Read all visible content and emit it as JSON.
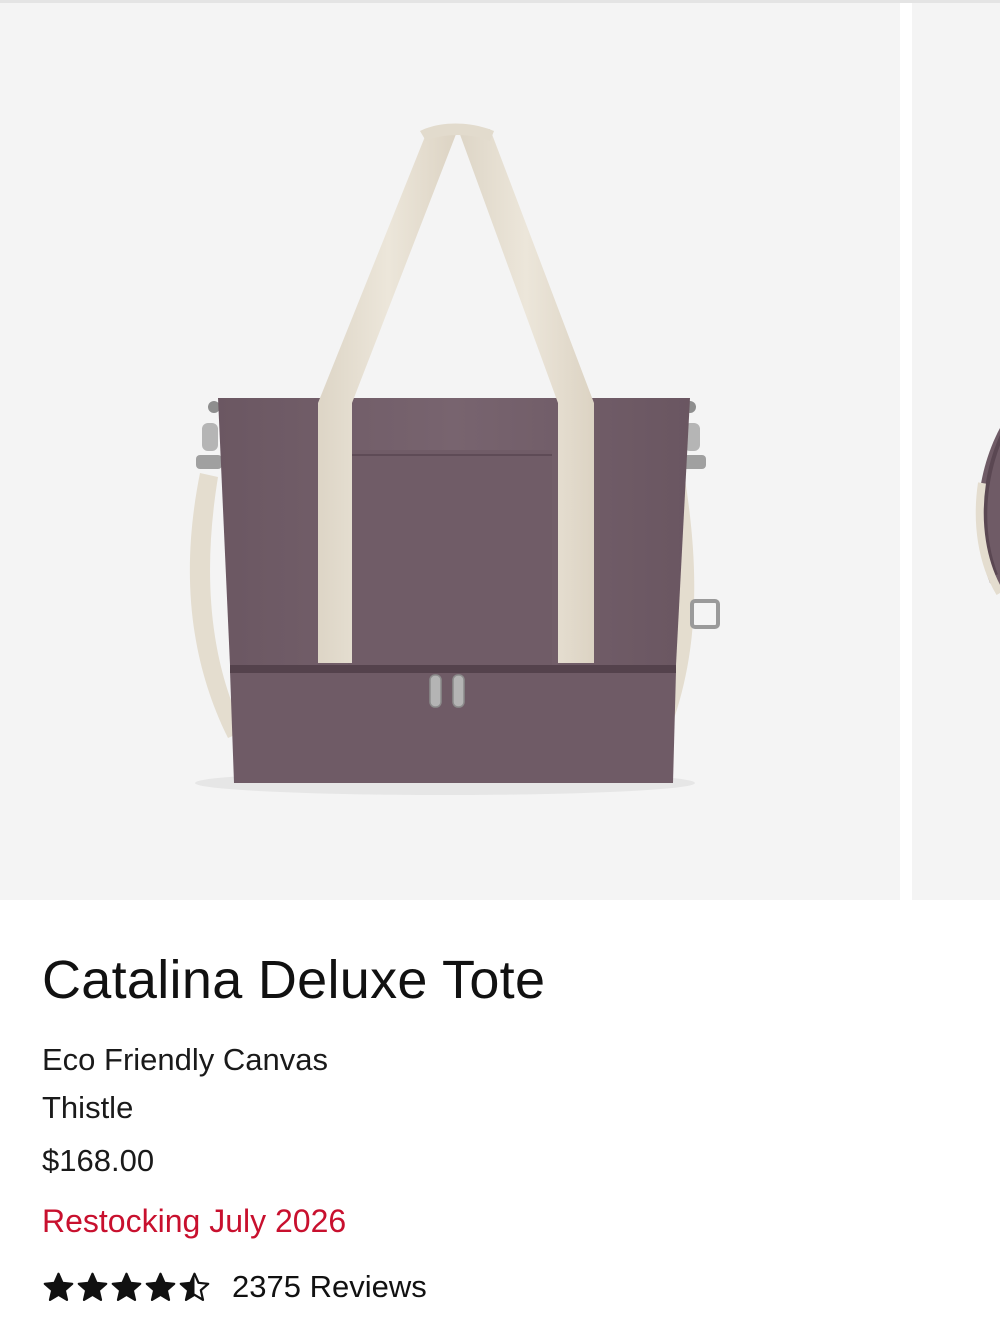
{
  "product": {
    "title": "Catalina Deluxe Tote",
    "material": "Eco Friendly Canvas",
    "color": "Thistle",
    "price": "$168.00",
    "availability": "Restocking July 2026",
    "rating": 4.5,
    "rating_max": 5,
    "reviews_label": "2375 Reviews"
  },
  "colors": {
    "bag_body": "#73606b",
    "strap": "#e8e1d3",
    "background": "#f4f4f4",
    "availability_text": "#c8102e"
  }
}
